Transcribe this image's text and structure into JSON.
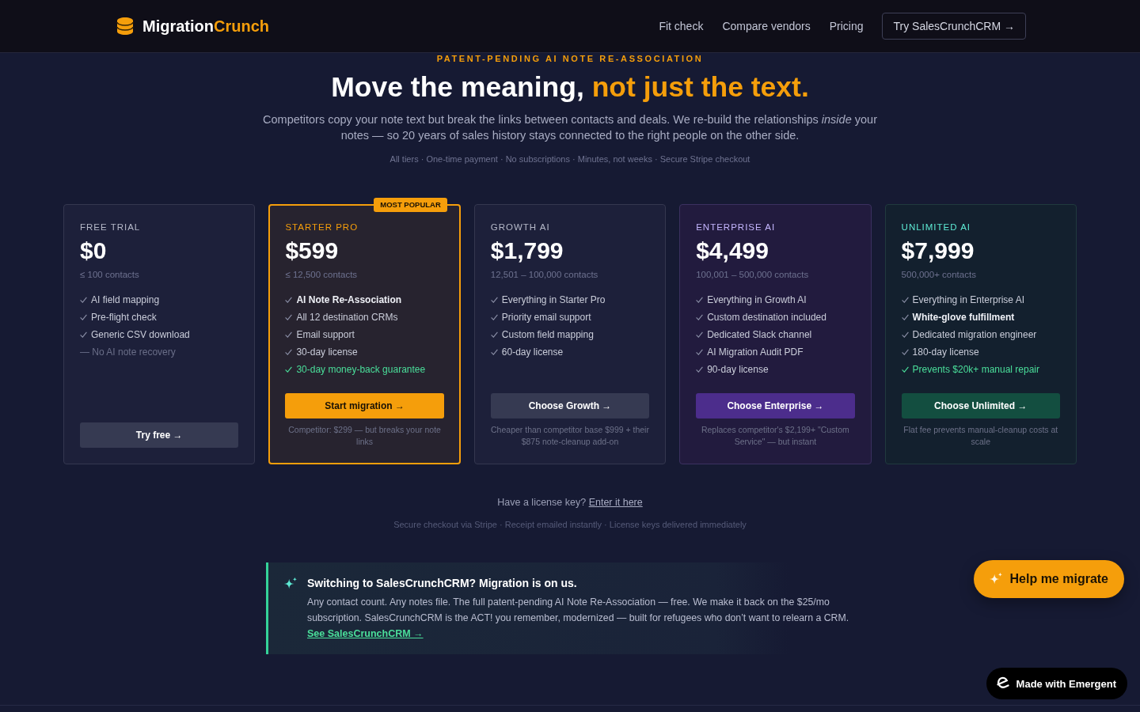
{
  "header": {
    "logo": {
      "text": "Migration",
      "accent": "Crunch"
    },
    "nav": [
      {
        "label": "Fit check"
      },
      {
        "label": "Compare vendors"
      },
      {
        "label": "Pricing"
      }
    ],
    "cta": "Try SalesCrunchCRM →"
  },
  "hero": {
    "eyebrow": "PATENT-PENDING AI NOTE RE-ASSOCIATION",
    "heading": {
      "text": "Move the meaning,",
      "accent": "not just the text."
    },
    "subtitle": "Competitors copy your note text but break the links between contacts and deals. We re-build the relationships *inside* your notes — so 20 years of sales history stays connected to the right people on the other side.",
    "facts": "All tiers · One-time payment · No subscriptions · Minutes, not weeks · Secure Stripe checkout"
  },
  "plans": [
    {
      "kind": "standard",
      "name": "FREE TRIAL",
      "price": "$0",
      "contacts": "≤ 100 contacts",
      "features": [
        {
          "text": "AI field mapping",
          "kind": "included"
        },
        {
          "text": "Pre-flight check",
          "kind": "included"
        },
        {
          "text": "Generic CSV download",
          "kind": "included"
        },
        {
          "text": "— No AI note recovery",
          "kind": "excluded"
        }
      ],
      "button": "Try free →"
    },
    {
      "kind": "popular",
      "badge": "MOST POPULAR",
      "name": "STARTER PRO",
      "price": "$599",
      "contacts": "≤ 12,500 contacts",
      "features": [
        {
          "text": "AI Note Re-Association",
          "kind": "bold"
        },
        {
          "text": "All 12 destination CRMs",
          "kind": "included"
        },
        {
          "text": "Email support",
          "kind": "included"
        },
        {
          "text": "30-day license",
          "kind": "included"
        },
        {
          "text": "30-day money-back guarantee",
          "kind": "highlight"
        }
      ],
      "button": "Start migration →",
      "note": "Competitor: $299 — but breaks your note links"
    },
    {
      "kind": "standard",
      "name": "GROWTH AI",
      "price": "$1,799",
      "contacts": "12,501 – 100,000 contacts",
      "features": [
        {
          "text": "Everything in Starter Pro",
          "kind": "included"
        },
        {
          "text": "Priority email support",
          "kind": "included"
        },
        {
          "text": "Custom field mapping",
          "kind": "included"
        },
        {
          "text": "60-day license",
          "kind": "included"
        }
      ],
      "button": "Choose Growth →",
      "note": "Cheaper than competitor base $999 + their $875 note-cleanup add-on"
    },
    {
      "kind": "enterprise",
      "name": "ENTERPRISE AI",
      "price": "$4,499",
      "contacts": "100,001 – 500,000 contacts",
      "features": [
        {
          "text": "Everything in Growth AI",
          "kind": "included"
        },
        {
          "text": "Custom destination included",
          "kind": "included"
        },
        {
          "text": "Dedicated Slack channel",
          "kind": "included"
        },
        {
          "text": "AI Migration Audit PDF",
          "kind": "included"
        },
        {
          "text": "90-day license",
          "kind": "included"
        }
      ],
      "button": "Choose Enterprise →",
      "note": "Replaces competitor's $2,199+ \"Custom Service\" — but instant"
    },
    {
      "kind": "unlimited",
      "name": "UNLIMITED AI",
      "price": "$7,999",
      "contacts": "500,000+ contacts",
      "features": [
        {
          "text": "Everything in Enterprise AI",
          "kind": "included"
        },
        {
          "text": "White-glove fulfillment",
          "kind": "bold"
        },
        {
          "text": "Dedicated migration engineer",
          "kind": "included"
        },
        {
          "text": "180-day license",
          "kind": "included"
        },
        {
          "text": "Prevents $20k+ manual repair",
          "kind": "highlight"
        }
      ],
      "button": "Choose Unlimited →",
      "note": "Flat fee prevents manual-cleanup costs at scale"
    }
  ],
  "license": {
    "text": "Have a license key?",
    "link": "Enter it here"
  },
  "checkout_note": "Secure checkout via Stripe · Receipt emailed instantly · License keys delivered immediately",
  "callout": {
    "title": "Switching to SalesCrunchCRM? Migration is on us.",
    "body": "Any contact count. Any notes file. The full patent-pending AI Note Re-Association — free. We make it back on the $25/mo subscription. SalesCrunchCRM is the ACT! you remember, modernized — built for refugees who don’t want to relearn a CRM.",
    "link": "See SalesCrunchCRM →"
  },
  "help_button": "Help me migrate",
  "made_with": "Made with Emergent"
}
